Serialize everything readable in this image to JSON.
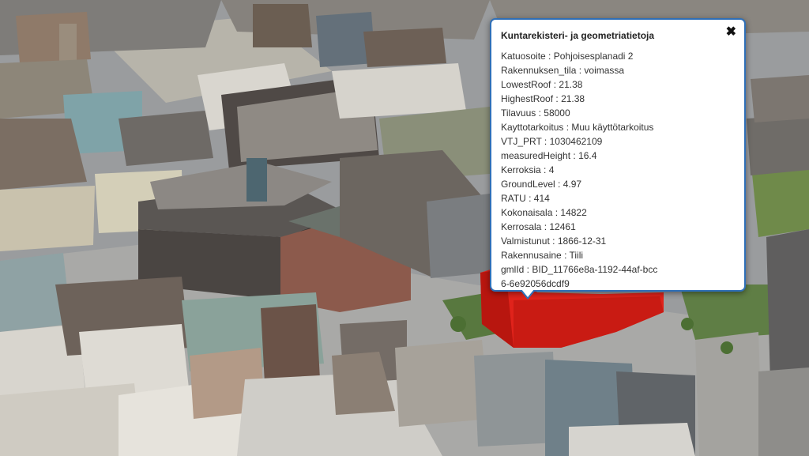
{
  "popup": {
    "title": "Kuntarekisteri- ja geometriatietoja",
    "close_icon": "close-icon",
    "attributes": [
      {
        "key": "Katuosoite",
        "value": "Pohjoisesplanadi 2"
      },
      {
        "key": "Rakennuksen_tila",
        "value": "voimassa"
      },
      {
        "key": "LowestRoof",
        "value": "21.38"
      },
      {
        "key": "HighestRoof",
        "value": "21.38"
      },
      {
        "key": "Tilavuus",
        "value": "58000"
      },
      {
        "key": "Kayttotarkoitus",
        "value": "Muu käyttötarkoitus"
      },
      {
        "key": "VTJ_PRT",
        "value": "1030462109"
      },
      {
        "key": "measuredHeight",
        "value": "16.4"
      },
      {
        "key": "Kerroksia",
        "value": "4"
      },
      {
        "key": "GroundLevel",
        "value": "4.97"
      },
      {
        "key": "RATU",
        "value": "414"
      },
      {
        "key": "Kokonaisala",
        "value": "14822"
      },
      {
        "key": "Kerrosala",
        "value": "12461"
      },
      {
        "key": "Valmistunut",
        "value": "1866-12-31"
      },
      {
        "key": "Rakennusaine",
        "value": "Tiili"
      },
      {
        "key": "gmlId",
        "value": "BID_11766e8a-1192-44af-bcc6-6e92056dcdf9"
      }
    ]
  },
  "map": {
    "selected_building_color": "#e0231b",
    "accent": "#2f6fb7"
  }
}
